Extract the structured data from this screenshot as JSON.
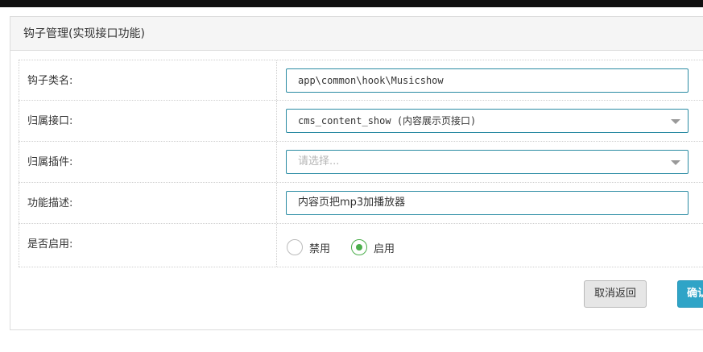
{
  "panel": {
    "title": "钩子管理(实现接口功能)"
  },
  "form": {
    "hook_name": {
      "label": "钩子类名:",
      "value": "app\\common\\hook\\Musicshow"
    },
    "interface": {
      "label": "归属接口:",
      "value": "cms_content_show (内容展示页接口)"
    },
    "plugin": {
      "label": "归属插件:",
      "placeholder": "请选择..."
    },
    "description": {
      "label": "功能描述:",
      "value": "内容页把mp3加播放器"
    },
    "enabled": {
      "label": "是否启用:",
      "options": [
        {
          "label": "禁用",
          "checked": false
        },
        {
          "label": "启用",
          "checked": true
        }
      ]
    }
  },
  "buttons": {
    "cancel": "取消返回",
    "confirm": "确认"
  },
  "colors": {
    "input_border": "#2a8ba3",
    "radio_checked": "#4cae4c",
    "confirm_bg": "#2fa4c7"
  }
}
